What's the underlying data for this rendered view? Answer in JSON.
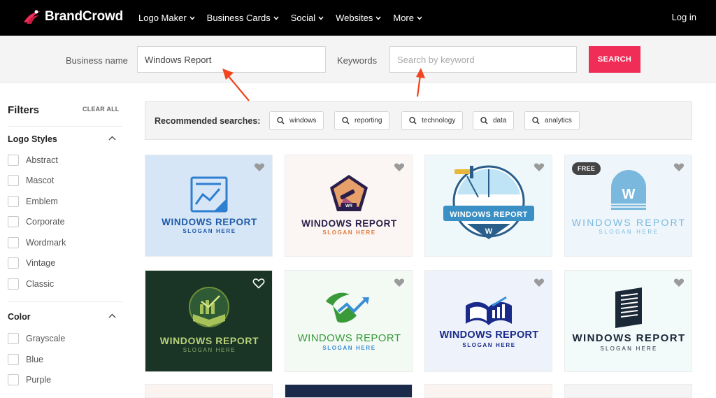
{
  "brand": {
    "name": "BrandCrowd",
    "logo_icon": "brand-swoosh-icon",
    "accent": "#ef2d56"
  },
  "nav": {
    "items": [
      {
        "label": "Logo Maker"
      },
      {
        "label": "Business Cards"
      },
      {
        "label": "Social"
      },
      {
        "label": "Websites"
      },
      {
        "label": "More"
      }
    ],
    "login": "Log in"
  },
  "search": {
    "business_label": "Business name",
    "business_value": "Windows Report",
    "keywords_label": "Keywords",
    "keywords_placeholder": "Search by keyword",
    "button": "SEARCH"
  },
  "sidebar": {
    "title": "Filters",
    "clear_all": "CLEAR ALL",
    "sections": [
      {
        "title": "Logo Styles",
        "options": [
          "Abstract",
          "Mascot",
          "Emblem",
          "Corporate",
          "Wordmark",
          "Vintage",
          "Classic"
        ]
      },
      {
        "title": "Color",
        "options": [
          "Grayscale",
          "Blue",
          "Purple"
        ]
      }
    ]
  },
  "recommended": {
    "title": "Recommended searches:",
    "chips": [
      "windows",
      "reporting",
      "technology",
      "data",
      "analytics"
    ]
  },
  "cards": [
    {
      "title": "WINDOWS REPORT",
      "slogan": "SLOGAN HERE",
      "bg": "#d6e6f7",
      "title_color": "#1e5aa8",
      "slogan_color": "#1e5aa8",
      "icon": "chart-document-icon"
    },
    {
      "title": "WINDOWS REPORT",
      "slogan": "SLOGAN HERE",
      "bg": "#fbf6f3",
      "title_color": "#2a1f4a",
      "slogan_color": "#e07a3c",
      "icon": "telescope-pentagon-icon"
    },
    {
      "title": "WINDOWS REPORT",
      "slogan": "",
      "bg": "#eef8fb",
      "title_color": "#ffffff",
      "slogan_color": "#2a5e8a",
      "icon": "window-cleaner-emblem-icon",
      "emblem_letter": "W"
    },
    {
      "title": "WINDOWS REPORT",
      "slogan": "SLOGAN HERE",
      "bg": "#eef6fb",
      "title_color": "#7bb8de",
      "slogan_color": "#7bb8de",
      "icon": "arch-window-icon",
      "badge": "FREE",
      "emblem_letter": "W"
    },
    {
      "title": "WINDOWS REPORT",
      "slogan": "SLOGAN HERE",
      "bg": "#1a3526",
      "title_color": "#b9d27a",
      "slogan_color": "#8aa86a",
      "icon": "book-chart-icon"
    },
    {
      "title": "WINDOWS REPORT",
      "slogan": "SLOGAN HERE",
      "bg": "#f2faf3",
      "title_color": "#3a9a3a",
      "slogan_color": "#3b8fd6",
      "icon": "trend-arrow-icon"
    },
    {
      "title": "WINDOWS REPORT",
      "slogan": "SLOGAN HERE",
      "bg": "#eef3fb",
      "title_color": "#1a2a8a",
      "slogan_color": "#1a2a8a",
      "icon": "open-book-bars-icon"
    },
    {
      "title": "WINDOWS REPORT",
      "slogan": "SLOGAN HERE",
      "bg": "#f2fafa",
      "title_color": "#1b2838",
      "slogan_color": "#1b2838",
      "icon": "building-blinds-icon"
    }
  ]
}
